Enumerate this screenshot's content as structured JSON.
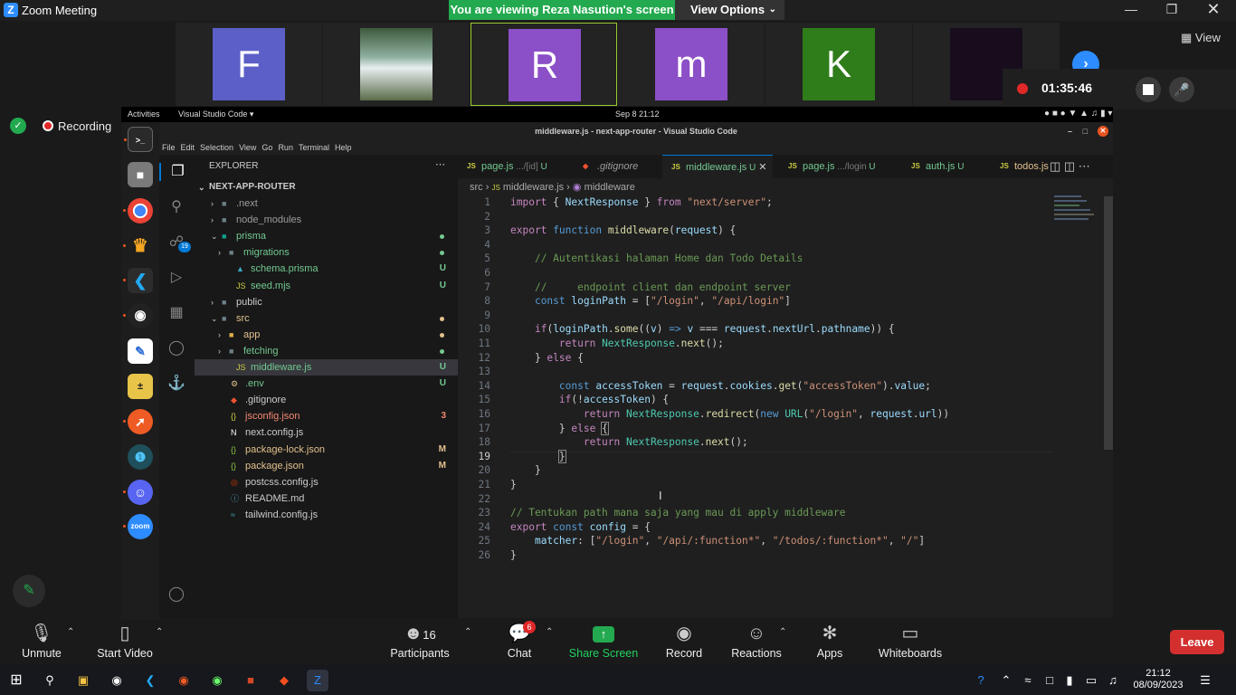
{
  "window": {
    "title": "Zoom Meeting",
    "logo": "Z",
    "share_banner": "You are viewing Reza Nasution's screen",
    "view_options": "View Options"
  },
  "participants": [
    {
      "initial": "F",
      "color": "#5b5fc7"
    },
    {
      "initial": "",
      "color": "#4a7a5a"
    },
    {
      "initial": "R",
      "color": "#8b4fc7"
    },
    {
      "initial": "m",
      "color": "#8b4fc7"
    },
    {
      "initial": "K",
      "color": "#2e7d1a"
    },
    {
      "initial": "",
      "color": "#170d1d"
    }
  ],
  "view_label": "View",
  "recording": {
    "timer": "01:35:46",
    "label": "Recording"
  },
  "ubuntu_bar": {
    "activities": "Activities",
    "app": "Visual Studio Code",
    "datetime": "Sep 8  21:12"
  },
  "vscode": {
    "title": "middleware.js - next-app-router - Visual Studio Code",
    "menu": [
      "File",
      "Edit",
      "Selection",
      "View",
      "Go",
      "Run",
      "Terminal",
      "Help"
    ],
    "explorer_title": "EXPLORER",
    "project": "NEXT-APP-ROUTER",
    "scm_badge": "19",
    "tree": [
      {
        "name": ".next",
        "status": "",
        "color": "#9d9d9d"
      },
      {
        "name": "node_modules",
        "status": "",
        "color": "#9d9d9d"
      },
      {
        "name": "prisma",
        "status": "dot",
        "color": "#73c991"
      },
      {
        "name": "migrations",
        "status": "dot",
        "color": "#73c991"
      },
      {
        "name": "schema.prisma",
        "status": "U",
        "color": "#73c991"
      },
      {
        "name": "seed.mjs",
        "status": "U",
        "color": "#73c991"
      },
      {
        "name": "public",
        "status": "",
        "color": "#cccccc"
      },
      {
        "name": "src",
        "status": "dot",
        "color": "#e2c08d"
      },
      {
        "name": "app",
        "status": "dot",
        "color": "#e2c08d"
      },
      {
        "name": "fetching",
        "status": "dot",
        "color": "#73c991"
      },
      {
        "name": "middleware.js",
        "status": "U",
        "color": "#73c991"
      },
      {
        "name": ".env",
        "status": "U",
        "color": "#73c991"
      },
      {
        "name": ".gitignore",
        "status": "",
        "color": "#cccccc"
      },
      {
        "name": "jsconfig.json",
        "status": "3",
        "color": "#f48771"
      },
      {
        "name": "next.config.js",
        "status": "",
        "color": "#cccccc"
      },
      {
        "name": "package-lock.json",
        "status": "M",
        "color": "#e2c08d"
      },
      {
        "name": "package.json",
        "status": "M",
        "color": "#e2c08d"
      },
      {
        "name": "postcss.config.js",
        "status": "",
        "color": "#cccccc"
      },
      {
        "name": "README.md",
        "status": "",
        "color": "#cccccc"
      },
      {
        "name": "tailwind.config.js",
        "status": "",
        "color": "#cccccc"
      }
    ],
    "tabs": [
      {
        "name": "page.js",
        "hint": ".../[id]",
        "status": "U"
      },
      {
        "name": ".gitignore",
        "hint": "",
        "status": ""
      },
      {
        "name": "middleware.js",
        "hint": "",
        "status": "U"
      },
      {
        "name": "page.js",
        "hint": ".../login",
        "status": "U"
      },
      {
        "name": "auth.js",
        "hint": "",
        "status": "U"
      },
      {
        "name": "todos.js",
        "hint": "",
        "status": ""
      }
    ],
    "breadcrumb": {
      "folder": "src",
      "file": "middleware.js",
      "symbol": "middleware"
    },
    "active_line": 19
  },
  "zoom_toolbar": {
    "unmute": "Unmute",
    "start_video": "Start Video",
    "participants_count": "16",
    "participants": "Participants",
    "chat": "Chat",
    "chat_badge": "6",
    "share": "Share Screen",
    "record": "Record",
    "reactions": "Reactions",
    "apps": "Apps",
    "whiteboards": "Whiteboards",
    "leave": "Leave"
  },
  "taskbar": {
    "time": "21:12",
    "date": "08/09/2023"
  }
}
